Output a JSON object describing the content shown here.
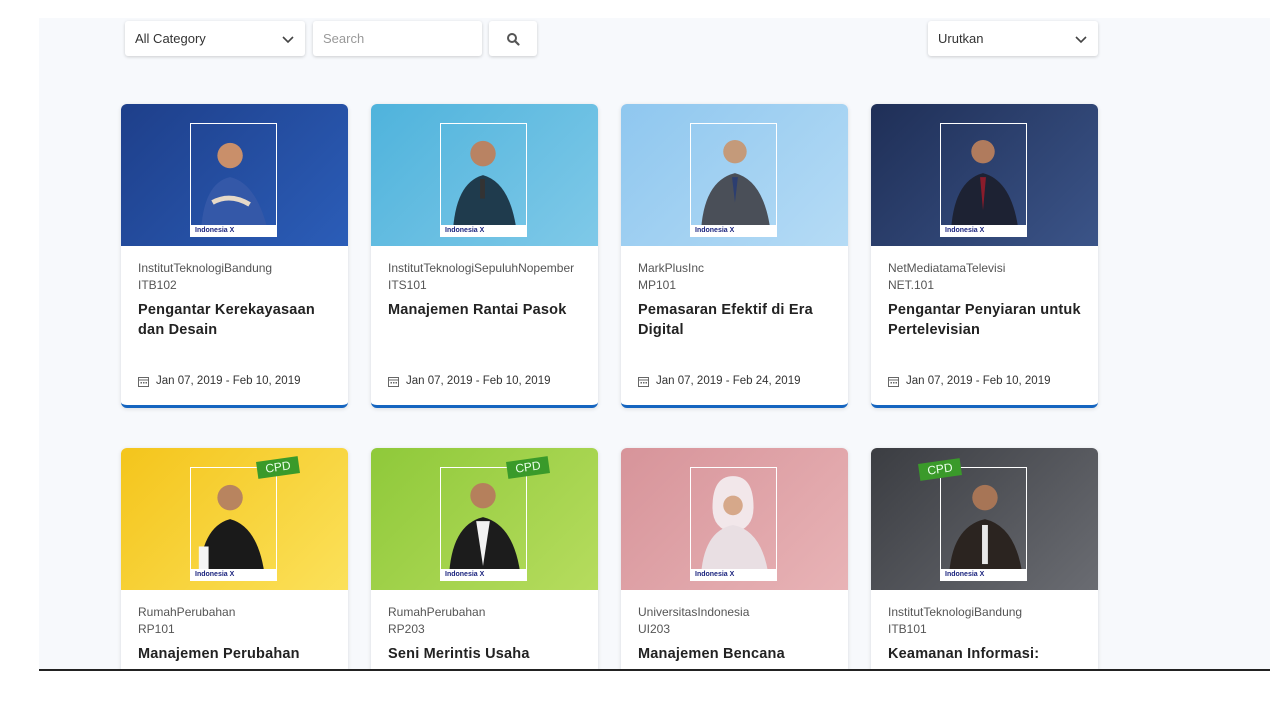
{
  "toolbar": {
    "category_value": "All Category",
    "search_placeholder": "Search",
    "sort_value": "Urutkan"
  },
  "brand_logo_text": "Indonesia X",
  "icons": {
    "chevron": "chevron-down-icon",
    "search": "search-icon",
    "calendar": "calendar-icon"
  },
  "colors": {
    "accent": "#1565c0",
    "cpd_badge": "#3a9a2a"
  },
  "courses": [
    {
      "institution": "InstitutTeknologiBandung",
      "code": "ITB102",
      "title": "Pengantar Kerekayasaan dan Desain",
      "date": "Jan 07, 2019 - Feb 10, 2019",
      "cpd": false
    },
    {
      "institution": "InstitutTeknologiSepuluhNopember",
      "code": "ITS101",
      "title": "Manajemen Rantai Pasok",
      "date": "Jan 07, 2019 - Feb 10, 2019",
      "cpd": false
    },
    {
      "institution": "MarkPlusInc",
      "code": "MP101",
      "title": "Pemasaran Efektif di Era Digital",
      "date": "Jan 07, 2019 - Feb 24, 2019",
      "cpd": false
    },
    {
      "institution": "NetMediatamaTelevisi",
      "code": "NET.101",
      "title": "Pengantar Penyiaran untuk Pertelevisian",
      "date": "Jan 07, 2019 - Feb 10, 2019",
      "cpd": false
    },
    {
      "institution": "RumahPerubahan",
      "code": "RP101",
      "title": "Manajemen Perubahan",
      "date": "",
      "cpd": true,
      "cpd_label": "CPD"
    },
    {
      "institution": "RumahPerubahan",
      "code": "RP203",
      "title": "Seni Merintis Usaha",
      "date": "",
      "cpd": true,
      "cpd_label": "CPD"
    },
    {
      "institution": "UniversitasIndonesia",
      "code": "UI203",
      "title": "Manajemen Bencana",
      "date": "",
      "cpd": false
    },
    {
      "institution": "InstitutTeknologiBandung",
      "code": "ITB101",
      "title": "Keamanan Informasi:",
      "date": "",
      "cpd": true,
      "cpd_label": "CPD"
    }
  ]
}
